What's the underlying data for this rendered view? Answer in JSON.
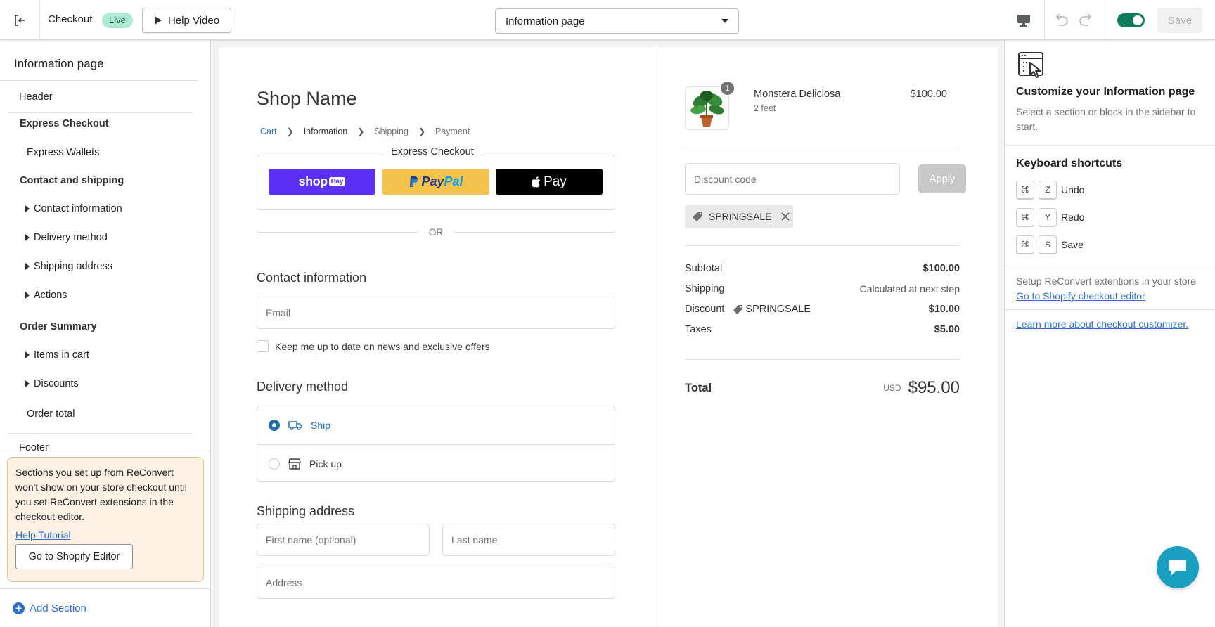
{
  "topbar": {
    "title": "Checkout",
    "live_badge": "Live",
    "help_video": "Help Video",
    "page_select": "Information page",
    "save": "Save",
    "toggle_on": true
  },
  "sidebar": {
    "title": "Information page",
    "items": [
      {
        "label": "Header"
      },
      {
        "label": "Express Checkout"
      },
      {
        "label": "Express Wallets"
      },
      {
        "label": "Contact and shipping"
      },
      {
        "label": "Contact information"
      },
      {
        "label": "Delivery method"
      },
      {
        "label": "Shipping address"
      },
      {
        "label": "Actions"
      },
      {
        "label": "Order Summary"
      },
      {
        "label": "Items in cart"
      },
      {
        "label": "Discounts"
      },
      {
        "label": "Order total"
      },
      {
        "label": "Footer"
      }
    ],
    "notice": {
      "text": "Sections you set up from ReConvert won't show on your store checkout until you set ReConvert extensions in the checkout editor.",
      "link": "Help Tutorial",
      "button": "Go to Shopify Editor"
    },
    "add_section": "Add Section"
  },
  "preview": {
    "shop_name": "Shop Name",
    "breadcrumb": [
      "Cart",
      "Information",
      "Shipping",
      "Payment"
    ],
    "express_label": "Express Checkout",
    "pay_buttons": {
      "shop_pay": "shop",
      "shop_pay_tag": "Pay",
      "paypal_a": "Pay",
      "paypal_b": "Pal",
      "apple_pay": "Pay"
    },
    "or": "OR",
    "contact_heading": "Contact information",
    "email_placeholder": "Email",
    "newsletter": "Keep me up to date on news and exclusive offers",
    "delivery_heading": "Delivery method",
    "delivery_options": [
      {
        "label": "Ship",
        "selected": true
      },
      {
        "label": "Pick up",
        "selected": false
      }
    ],
    "shipping_heading": "Shipping address",
    "first_name_placeholder": "First name (optional)",
    "last_name_placeholder": "Last name",
    "address_placeholder": "Address"
  },
  "summary": {
    "product": {
      "name": "Monstera Deliciosa",
      "variant": "2 feet",
      "price": "$100.00",
      "quantity": "1"
    },
    "discount_placeholder": "Discount code",
    "apply": "Apply",
    "applied_code": "SPRINGSALE",
    "lines": {
      "subtotal_label": "Subtotal",
      "subtotal_value": "$100.00",
      "shipping_label": "Shipping",
      "shipping_value": "Calculated at next step",
      "discount_label": "Discount",
      "discount_code": "SPRINGSALE",
      "discount_value": "$10.00",
      "taxes_label": "Taxes",
      "taxes_value": "$5.00"
    },
    "total_label": "Total",
    "currency": "USD",
    "total_value": "$95.00"
  },
  "right_panel": {
    "title": "Customize your Information page",
    "description": "Select a section or block in the sidebar to start.",
    "shortcuts_heading": "Keyboard shortcuts",
    "shortcuts": [
      {
        "mod": "⌘",
        "key": "Z",
        "label": "Undo"
      },
      {
        "mod": "⌘",
        "key": "Y",
        "label": "Redo"
      },
      {
        "mod": "⌘",
        "key": "S",
        "label": "Save"
      }
    ],
    "setup_text": "Setup ReConvert extentions in your store",
    "setup_link": "Go to Shopify checkout editor",
    "learn_link": "Learn more about checkout customizer."
  },
  "colors": {
    "accent_blue": "#2c6ecb",
    "toggle_green": "#0f7b5c",
    "live_badge_bg": "#aee9d1",
    "shop_pay": "#5a31f4",
    "paypal": "#ffc439",
    "apple_pay": "#000000",
    "chat_button": "#1a9fc1",
    "notice_bg": "#fdf2e3"
  }
}
